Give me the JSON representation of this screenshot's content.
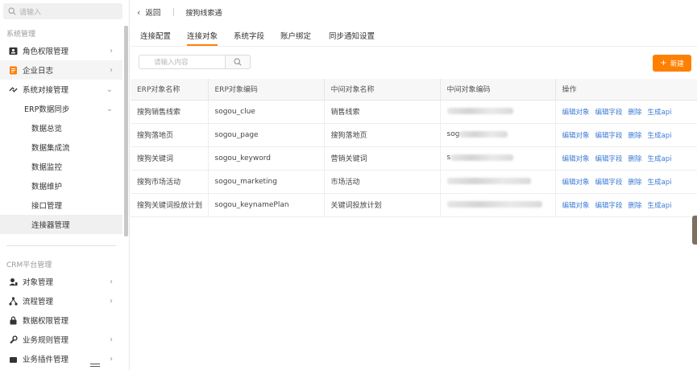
{
  "sidebar": {
    "search_placeholder": "请输入",
    "group1_title": "系统管理",
    "group2_title": "CRM平台管理",
    "items": [
      {
        "label": "角色权限管理",
        "icon": "user-card-icon"
      },
      {
        "label": "企业日志",
        "icon": "log-icon"
      },
      {
        "label": "系统对接管理",
        "icon": "link-icon"
      }
    ],
    "erp_sync": "ERP数据同步",
    "sub_items": [
      "数据总览",
      "数据集成流",
      "数据监控",
      "数据维护",
      "接口管理",
      "连接器管理"
    ],
    "crm_items": [
      {
        "label": "对象管理",
        "icon": "object-icon"
      },
      {
        "label": "流程管理",
        "icon": "flow-icon"
      },
      {
        "label": "数据权限管理",
        "icon": "lock-icon"
      },
      {
        "label": "业务规则管理",
        "icon": "wrench-icon"
      },
      {
        "label": "业务插件管理",
        "icon": "plugin-icon"
      }
    ]
  },
  "header": {
    "back_label": "返回",
    "title": "搜狗线索通"
  },
  "tabs": [
    "连接配置",
    "连接对象",
    "系统字段",
    "账户绑定",
    "同步通知设置"
  ],
  "active_tab": 1,
  "toolbar": {
    "search_placeholder": "请输入内容",
    "new_label": "新建"
  },
  "table": {
    "columns": [
      "ERP对象名称",
      "ERP对象编码",
      "中间对象名称",
      "中间对象编码",
      "操作"
    ],
    "rows": [
      {
        "name": "搜狗销售线索",
        "code": "sogou_clue",
        "mid_name": "销售线索",
        "mid_code_prefix": ""
      },
      {
        "name": "搜狗落地页",
        "code": "sogou_page",
        "mid_name": "搜狗落地页",
        "mid_code_prefix": "sog"
      },
      {
        "name": "搜狗关键词",
        "code": "sogou_keyword",
        "mid_name": "营销关键词",
        "mid_code_prefix": "s"
      },
      {
        "name": "搜狗市场活动",
        "code": "sogou_marketing",
        "mid_name": "市场活动",
        "mid_code_prefix": ""
      },
      {
        "name": "搜狗关键词投放计划",
        "code": "sogou_keynamePlan",
        "mid_name": "关键词投放计划",
        "mid_code_prefix": ""
      }
    ],
    "actions": [
      "编辑对象",
      "编辑字段",
      "删除",
      "生成api"
    ]
  },
  "colors": {
    "accent": "#ff8000",
    "link": "#3a7bd5"
  }
}
